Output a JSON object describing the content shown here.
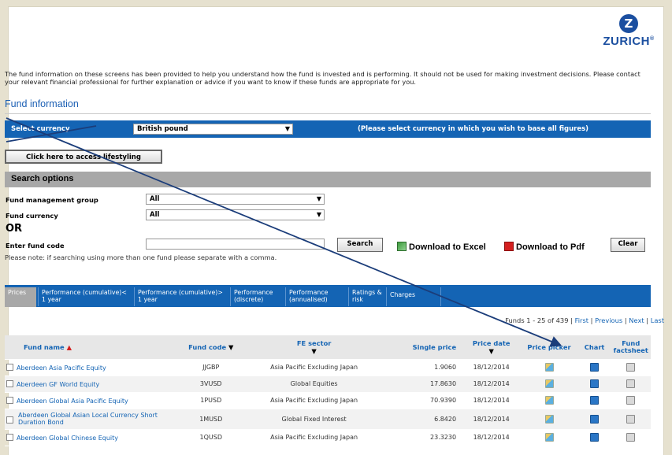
{
  "brand": {
    "name": "ZURICH",
    "mark": "Z",
    "reg": "®",
    "color": "#1b4fa0"
  },
  "disclaimer": "The fund information on these screens has been provided to help you understand how the fund is invested and is performing. It should not be used for making investment decisions. Please contact your relevant financial professional for further explanation or advice if you want to know if these funds are appropriate for you.",
  "section_title": "Fund information",
  "currency": {
    "label": "Select currency",
    "selected": "British pound",
    "hint": "(Please select currency in which you wish to base all figures)"
  },
  "lifestyle_button": "Click here to access lifestyling",
  "search": {
    "heading": "Search options",
    "fund_group_label": "Fund management group",
    "fund_group_value": "All",
    "fund_currency_label": "Fund currency",
    "fund_currency_value": "All",
    "or_label": "OR",
    "fund_code_label": "Enter fund code",
    "fund_code_value": "",
    "search_button": "Search",
    "download_excel": "Download to Excel",
    "download_pdf": "Download to Pdf",
    "clear_button": "Clear",
    "note": "Please note: if searching using more than one fund please separate with a comma."
  },
  "tabs": [
    {
      "label": "Prices"
    },
    {
      "label": "Performance (cumulative)< 1 year"
    },
    {
      "label": "Performance (cumulative)> 1 year"
    },
    {
      "label": "Performance (discrete)"
    },
    {
      "label": "Performance (annualised)"
    },
    {
      "label": "Ratings & risk"
    },
    {
      "label": "Charges"
    }
  ],
  "pager": {
    "summary": "Funds 1 - 25 of 439",
    "first": "First",
    "previous": "Previous",
    "next": "Next",
    "last": "Last"
  },
  "table": {
    "headers": {
      "name": "Fund name",
      "code": "Fund code",
      "sector": "FE sector",
      "price": "Single price",
      "date": "Price date",
      "picker": "Price picker",
      "chart": "Chart",
      "factsheet": "Fund factsheet"
    },
    "rows": [
      {
        "name": "Aberdeen Asia Pacific Equity",
        "code": "JJGBP",
        "sector": "Asia Pacific Excluding Japan",
        "price": "1.9060",
        "date": "18/12/2014"
      },
      {
        "name": "Aberdeen GF World Equity",
        "code": "3VUSD",
        "sector": "Global Equities",
        "price": "17.8630",
        "date": "18/12/2014"
      },
      {
        "name": "Aberdeen Global Asia Pacific Equity",
        "code": "1PUSD",
        "sector": "Asia Pacific Excluding Japan",
        "price": "70.9390",
        "date": "18/12/2014"
      },
      {
        "name": "Aberdeen Global Asian Local Currency Short Duration Bond",
        "code": "1MUSD",
        "sector": "Global Fixed Interest",
        "price": "6.8420",
        "date": "18/12/2014"
      },
      {
        "name": "Aberdeen Global Chinese Equity",
        "code": "1QUSD",
        "sector": "Asia Pacific Excluding Japan",
        "price": "23.3230",
        "date": "18/12/2014"
      }
    ]
  },
  "colors": {
    "bar": "#1464b4",
    "grey_bar": "#a8a8a8",
    "link": "#1464b4"
  }
}
